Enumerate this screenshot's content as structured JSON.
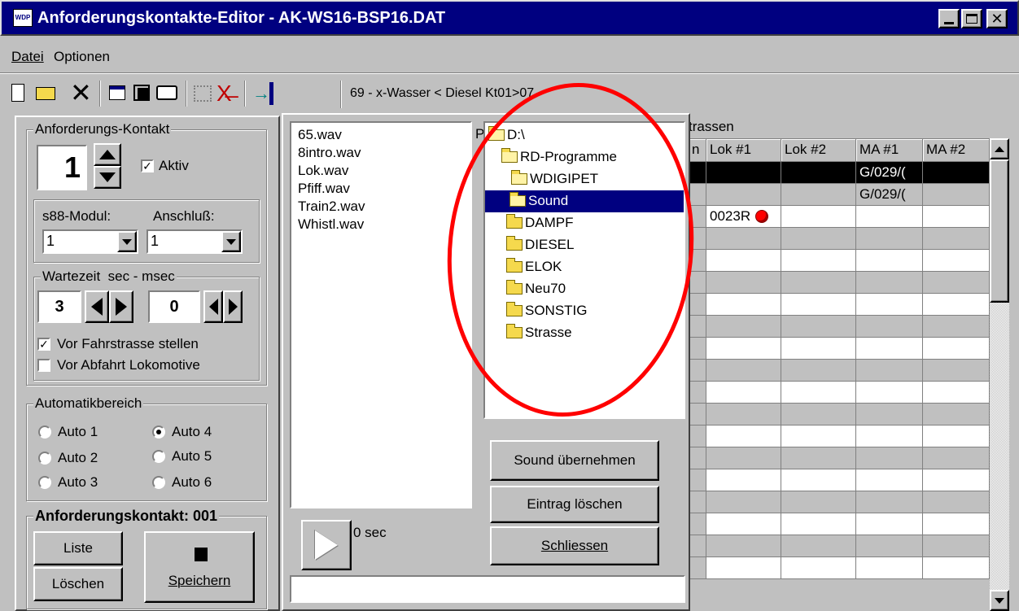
{
  "window": {
    "title": "Anforderungskontakte-Editor - AK-WS16-BSP16.DAT"
  },
  "menu": {
    "items": [
      "Datei",
      "Optionen"
    ]
  },
  "toolbar": {
    "status_text": "69 - x-Wasser < Diesel Kt01>07"
  },
  "left": {
    "contact_group": "Anforderungs-Kontakt",
    "contact_value": "1",
    "active_label": "Aktiv",
    "s88_label": "s88-Modul:",
    "s88_value": "1",
    "anschluss_label": "Anschluß:",
    "anschluss_value": "1",
    "wait_label": "Wartezeit  sec - msec",
    "wait_sec": "3",
    "wait_msec": "0",
    "chk_fahrstrasse": "Vor Fahrstrasse stellen",
    "chk_abfahrt": "Vor Abfahrt Lokomotive",
    "auto_group": "Automatikbereich",
    "auto": [
      "Auto 1",
      "Auto 4",
      "Auto 2",
      "Auto 5",
      "Auto 3",
      "Auto 6"
    ],
    "contact_title": "Anforderungskontakt: 001",
    "btn_liste": "Liste",
    "btn_loeschen": "Löschen",
    "btn_speichern": "Speichern"
  },
  "sound": {
    "files": [
      "65.wav",
      "8intro.wav",
      "Lok.wav",
      "Pfiff.wav",
      "Train2.wav",
      "Whistl.wav"
    ],
    "folders": [
      {
        "name": "D:\\",
        "open": true
      },
      {
        "name": "RD-Programme",
        "open": true
      },
      {
        "name": "WDIGIPET",
        "open": true
      },
      {
        "name": "Sound",
        "open": true,
        "selected": true
      },
      {
        "name": "DAMPF"
      },
      {
        "name": "DIESEL"
      },
      {
        "name": "ELOK"
      },
      {
        "name": "Neu70"
      },
      {
        "name": "SONSTIG"
      },
      {
        "name": "Strasse"
      }
    ],
    "hidden_letter": "P",
    "duration_text": "0 sec",
    "btn_uebernehmen": "Sound übernehmen",
    "btn_eintrag": "Eintrag löschen",
    "btn_schliessen": "Schliessen"
  },
  "grid": {
    "title_fragment": "trassen",
    "columns": [
      "n",
      "Lok #1",
      "Lok #2",
      "MA #1",
      "MA #2"
    ],
    "rows": [
      {
        "selected": true,
        "cells": [
          "",
          "",
          "",
          "G/029/(",
          ""
        ]
      },
      {
        "cells": [
          "",
          "",
          "",
          "G/029/(",
          ""
        ]
      },
      {
        "cells": [
          "",
          "0023R",
          "",
          "",
          ""
        ],
        "dot": true
      }
    ],
    "empty_rows": 16
  },
  "colors": {
    "titlebar": "#000080",
    "selection": "#000080",
    "annotation": "#ff0000",
    "dot": "#ff0000"
  }
}
